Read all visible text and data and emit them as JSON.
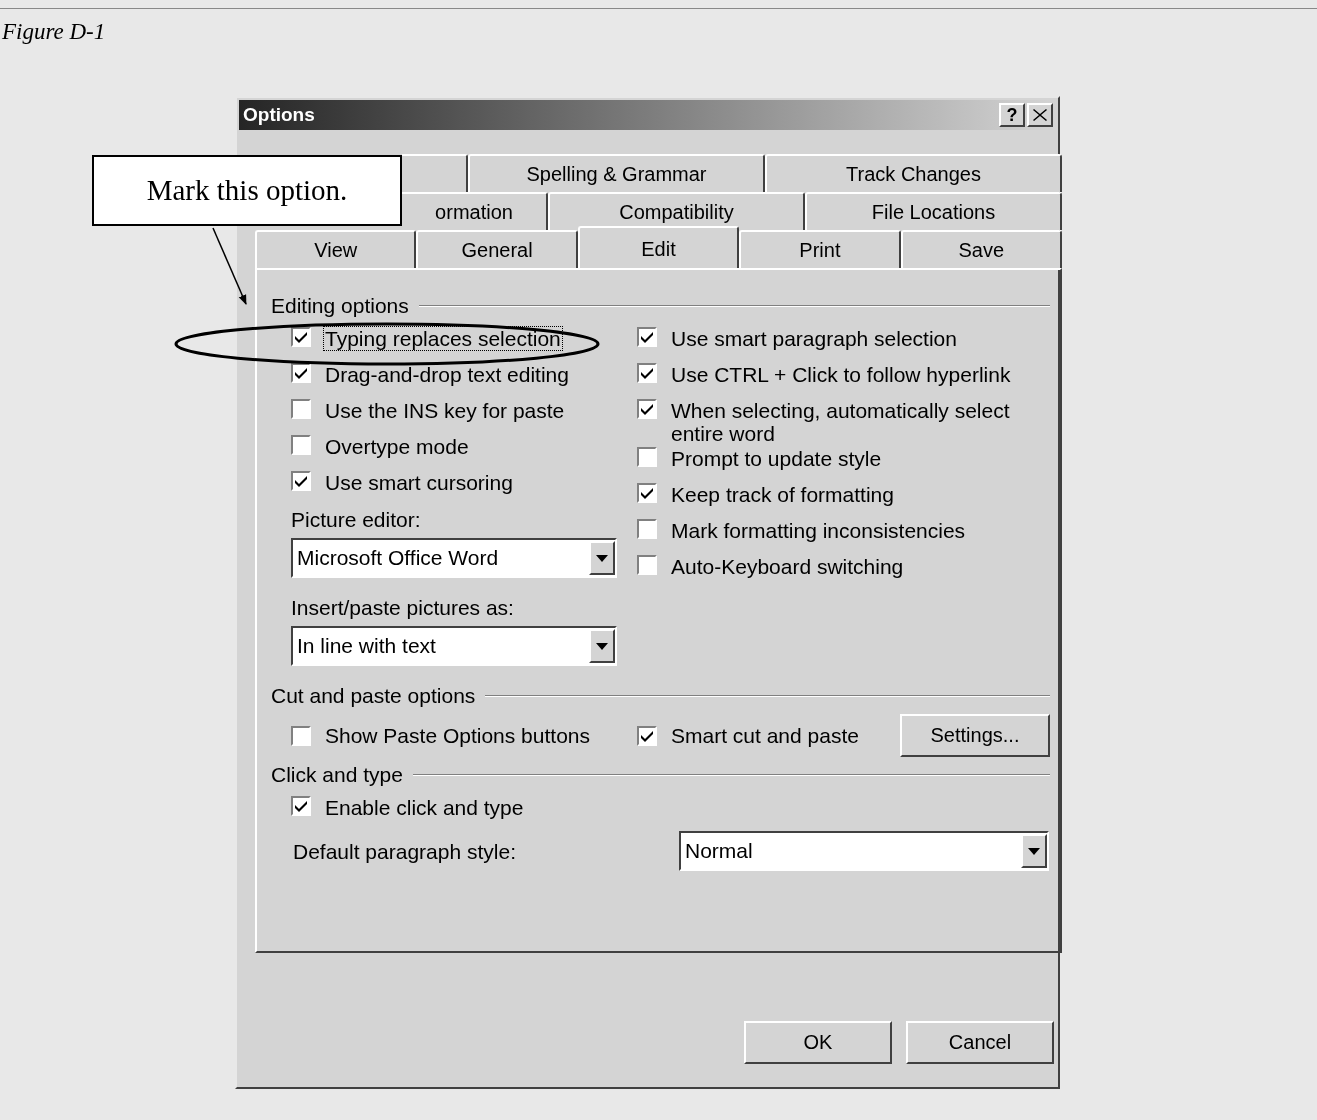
{
  "document": {
    "caption": "Figure D-1",
    "callout": "Mark this option."
  },
  "dialog": {
    "title": "Options",
    "help_button": "?",
    "tab_rows": [
      [
        {
          "selected": false
        },
        {
          "label": "Spelling & Grammar",
          "selected": false
        },
        {
          "label": "Track Changes",
          "selected": false
        }
      ],
      [
        {
          "label": "ormation",
          "selected": false
        },
        {
          "label": "Compatibility",
          "selected": false
        },
        {
          "label": "File Locations",
          "selected": false
        }
      ],
      [
        {
          "label": "View",
          "selected": false
        },
        {
          "label": "General",
          "selected": false
        },
        {
          "label": "Edit",
          "selected": true
        },
        {
          "label": "Print",
          "selected": false
        },
        {
          "label": "Save",
          "selected": false
        }
      ]
    ],
    "editing_options": {
      "title": "Editing options",
      "left": [
        {
          "kind": "checkbox",
          "label": "Typing replaces selection",
          "checked": true,
          "focused": true
        },
        {
          "kind": "checkbox",
          "label": "Drag-and-drop text editing",
          "checked": true,
          "focused": false
        },
        {
          "kind": "checkbox",
          "label": "Use the INS key for paste",
          "checked": false,
          "focused": false
        },
        {
          "kind": "checkbox",
          "label": "Overtype mode",
          "checked": false,
          "focused": false
        },
        {
          "kind": "checkbox",
          "label": "Use smart cursoring",
          "checked": true,
          "focused": false
        },
        {
          "kind": "dropdown",
          "label": "Picture editor:",
          "value": "Microsoft Office Word"
        },
        {
          "kind": "dropdown",
          "label": "Insert/paste pictures as:",
          "value": "In line with text"
        }
      ],
      "right": [
        {
          "kind": "checkbox",
          "label": "Use smart paragraph selection",
          "checked": true,
          "focused": false
        },
        {
          "kind": "checkbox",
          "label": "Use CTRL + Click to follow hyperlink",
          "checked": true,
          "focused": false
        },
        {
          "kind": "checkbox",
          "label": "When selecting, automatically select entire word",
          "checked": true,
          "focused": false
        },
        {
          "kind": "checkbox",
          "label": "Prompt to update style",
          "checked": false,
          "focused": false
        },
        {
          "kind": "checkbox",
          "label": "Keep track of formatting",
          "checked": true,
          "focused": false
        },
        {
          "kind": "checkbox",
          "label": "Mark formatting inconsistencies",
          "checked": false,
          "focused": false
        },
        {
          "kind": "checkbox",
          "label": "Auto-Keyboard switching",
          "checked": false,
          "focused": false
        }
      ]
    },
    "cut_and_paste": {
      "title": "Cut and paste options",
      "items": [
        {
          "kind": "checkbox",
          "label": "Show Paste Options buttons",
          "checked": false,
          "focused": false
        },
        {
          "kind": "checkbox",
          "label": "Smart cut and paste",
          "checked": true,
          "focused": false
        },
        {
          "kind": "button",
          "label": "Settings..."
        }
      ]
    },
    "click_and_type": {
      "title": "Click and type",
      "items": [
        {
          "kind": "checkbox",
          "label": "Enable click and type",
          "checked": true,
          "focused": false
        },
        {
          "kind": "inline-dropdown",
          "label": "Default paragraph style:",
          "value": "Normal"
        }
      ]
    },
    "buttons": [
      "OK",
      "Cancel"
    ]
  }
}
